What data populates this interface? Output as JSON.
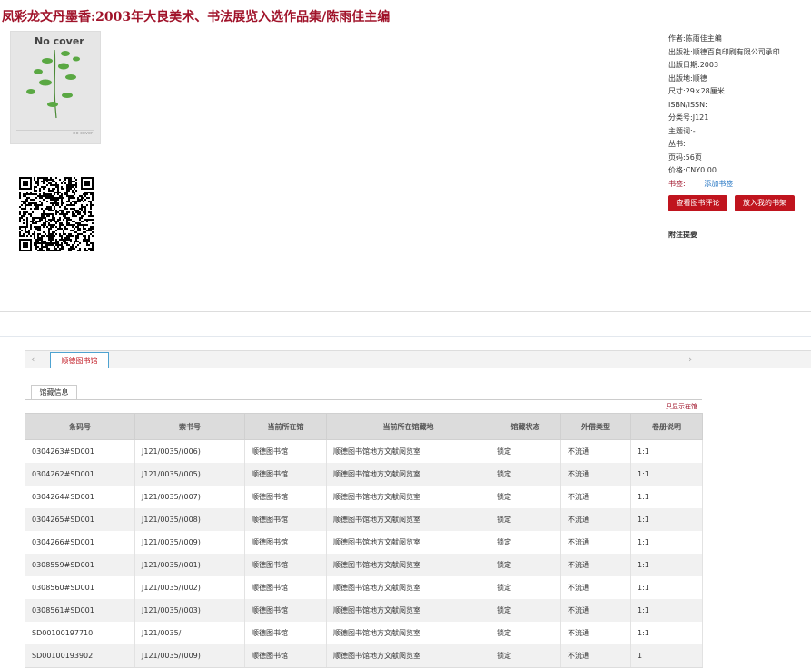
{
  "book": {
    "title": "凤彩龙文丹墨香:2003年大良美术、书法展览入选作品集/陈雨佳主编",
    "cover_text": "No cover",
    "cover_footer": "no cover"
  },
  "meta": [
    {
      "label": "作者:",
      "value": "陈雨佳主编"
    },
    {
      "label": "出版社:",
      "value": "顺德百良印刷有限公司承印"
    },
    {
      "label": "出版日期:",
      "value": "2003"
    },
    {
      "label": "出版地:",
      "value": "顺德"
    },
    {
      "label": "尺寸:",
      "value": "29×28厘米"
    },
    {
      "label": "ISBN/ISSN:",
      "value": ""
    },
    {
      "label": "分类号:",
      "value": "J121"
    },
    {
      "label": "主题词:",
      "value": "-"
    },
    {
      "label": "丛书:",
      "value": ""
    },
    {
      "label": "页码:",
      "value": "56页"
    },
    {
      "label": "价格:",
      "value": "CNY0.00"
    }
  ],
  "bookmark": {
    "label": "书签:",
    "link": "添加书签"
  },
  "buttons": {
    "review": "查看图书评论",
    "shelf": "放入我的书架"
  },
  "note_label": "附注提要",
  "tabs": {
    "library": "顺德图书馆",
    "holdings": "馆藏信息"
  },
  "only_show": "只显示在馆",
  "table": {
    "headers": [
      "条码号",
      "索书号",
      "当前所在馆",
      "当前所在馆藏地",
      "馆藏状态",
      "外借类型",
      "卷册说明"
    ],
    "rows": [
      [
        "0304263#SD001",
        "J121/0035/(006)",
        "顺德图书馆",
        "顺德图书馆地方文献阅览室",
        "锁定",
        "不流通",
        "1:1"
      ],
      [
        "0304262#SD001",
        "J121/0035/(005)",
        "顺德图书馆",
        "顺德图书馆地方文献阅览室",
        "锁定",
        "不流通",
        "1:1"
      ],
      [
        "0304264#SD001",
        "J121/0035/(007)",
        "顺德图书馆",
        "顺德图书馆地方文献阅览室",
        "锁定",
        "不流通",
        "1:1"
      ],
      [
        "0304265#SD001",
        "J121/0035/(008)",
        "顺德图书馆",
        "顺德图书馆地方文献阅览室",
        "锁定",
        "不流通",
        "1:1"
      ],
      [
        "0304266#SD001",
        "J121/0035/(009)",
        "顺德图书馆",
        "顺德图书馆地方文献阅览室",
        "锁定",
        "不流通",
        "1:1"
      ],
      [
        "0308559#SD001",
        "J121/0035/(001)",
        "顺德图书馆",
        "顺德图书馆地方文献阅览室",
        "锁定",
        "不流通",
        "1:1"
      ],
      [
        "0308560#SD001",
        "J121/0035/(002)",
        "顺德图书馆",
        "顺德图书馆地方文献阅览室",
        "锁定",
        "不流通",
        "1:1"
      ],
      [
        "0308561#SD001",
        "J121/0035/(003)",
        "顺德图书馆",
        "顺德图书馆地方文献阅览室",
        "锁定",
        "不流通",
        "1:1"
      ],
      [
        "SD00100197710",
        "J121/0035/",
        "顺德图书馆",
        "顺德图书馆地方文献阅览室",
        "锁定",
        "不流通",
        "1:1"
      ],
      [
        "SD00100193902",
        "J121/0035/(009)",
        "顺德图书馆",
        "顺德图书馆地方文献阅览室",
        "锁定",
        "不流通",
        "1"
      ]
    ]
  },
  "colors": {
    "brand": "#a0132a",
    "button": "#c0141e",
    "link": "#1a6fc0"
  }
}
